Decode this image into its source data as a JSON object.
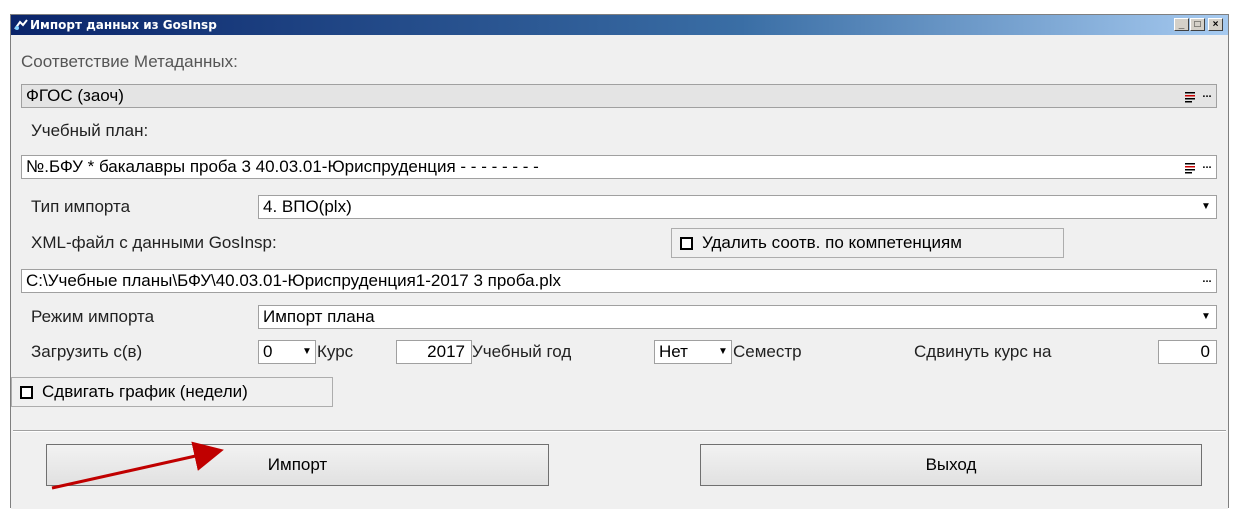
{
  "window": {
    "title": "Импорт данных из GosInsp",
    "buttons": {
      "minimize": "_",
      "maximize": "□",
      "close": "×"
    }
  },
  "form": {
    "metadata_label": "Соответствие Метаданных:",
    "metadata_value": "ФГОС (заоч)",
    "plan_label": "Учебный план:",
    "plan_value": "№.БФУ * бакалавры проба 3 40.03.01-Юриспруденция -  -  -  -  -  -  -  -",
    "import_type_label": "Тип импорта",
    "import_type_value": "4. ВПО(plx)",
    "xml_label": "XML-файл с данными GosInsp:",
    "delete_competence_label": "Удалить соотв. по компетенциям",
    "delete_competence_checked": false,
    "file_path": "C:\\Учебные планы\\БФУ\\40.03.01-Юриспруденция1-2017 3 проба.plx",
    "import_mode_label": "Режим импорта",
    "import_mode_value": "Импорт плана",
    "load_from_label": "Загрузить с(в)",
    "course_value": "0",
    "course_label": "Курс",
    "year_value": "2017",
    "year_label": "Учебный год",
    "semester_value": "Нет",
    "semester_label": "Семестр",
    "shift_course_label": "Сдвинуть курс на",
    "shift_course_value": "0",
    "shift_schedule_label": "Сдвигать график (недели)",
    "shift_schedule_checked": false
  },
  "actions": {
    "import_label": "Импорт",
    "exit_label": "Выход"
  },
  "icons": {
    "dropdown": "chevron-down-icon",
    "ellipsis": "ellipsis-icon",
    "list": "list-icon",
    "arrow_color": "#c00000"
  }
}
